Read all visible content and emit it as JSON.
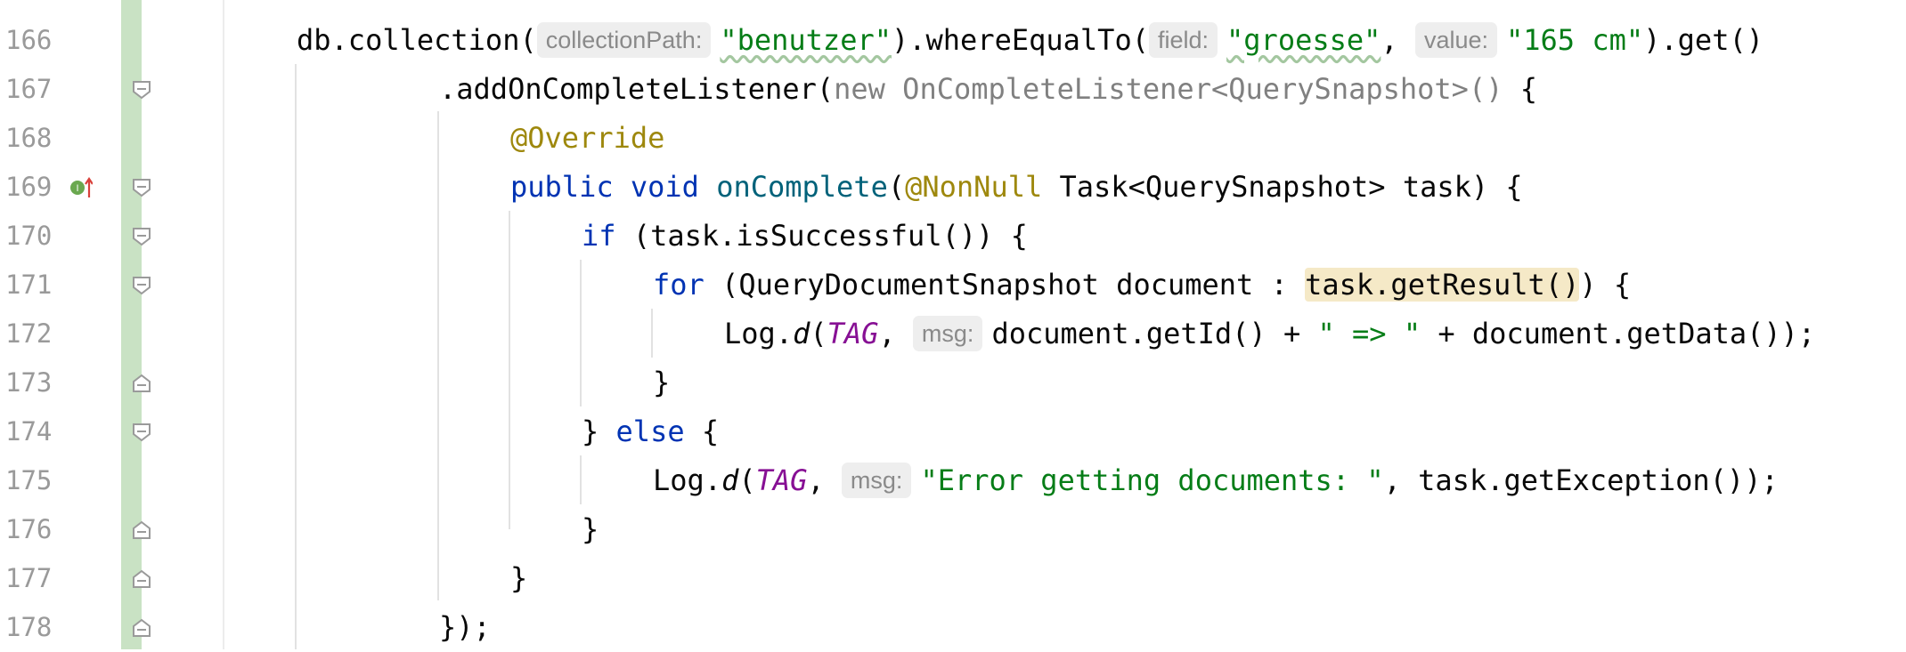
{
  "editor": {
    "lines": [
      {
        "number": "166",
        "tokens": [
          {
            "t": "db.collection(",
            "c": ""
          },
          {
            "t": "collectionPath:",
            "c": "hint"
          },
          {
            "t": "\"benutzer\"",
            "c": "str squiggle"
          },
          {
            "t": ").whereEqualTo(",
            "c": ""
          },
          {
            "t": "field:",
            "c": "hint"
          },
          {
            "t": "\"groesse\"",
            "c": "str squiggle"
          },
          {
            "t": ", ",
            "c": ""
          },
          {
            "t": "value:",
            "c": "hint"
          },
          {
            "t": "\"165 cm\"",
            "c": "str"
          },
          {
            "t": ").get()",
            "c": ""
          }
        ]
      },
      {
        "number": "167",
        "tokens": [
          {
            "t": ".addOnCompleteListener(",
            "c": ""
          },
          {
            "t": "new OnCompleteListener<QuerySnapshot>() ",
            "c": "grey"
          },
          {
            "t": "{",
            "c": ""
          }
        ]
      },
      {
        "number": "168",
        "tokens": [
          {
            "t": "@Override",
            "c": "ann"
          }
        ]
      },
      {
        "number": "169",
        "tokens": [
          {
            "t": "public void ",
            "c": "kw"
          },
          {
            "t": "onComplete",
            "c": "fn"
          },
          {
            "t": "(",
            "c": ""
          },
          {
            "t": "@NonNull",
            "c": "ann"
          },
          {
            "t": " Task<QuerySnapshot> task) {",
            "c": ""
          }
        ]
      },
      {
        "number": "170",
        "tokens": [
          {
            "t": "if",
            "c": "kw"
          },
          {
            "t": " (task.isSuccessful()) {",
            "c": ""
          }
        ]
      },
      {
        "number": "171",
        "tokens": [
          {
            "t": "for",
            "c": "kw"
          },
          {
            "t": " (QueryDocumentSnapshot document : ",
            "c": ""
          },
          {
            "t": "task.getResult()",
            "c": "hl"
          },
          {
            "t": ") {",
            "c": ""
          }
        ]
      },
      {
        "number": "172",
        "tokens": [
          {
            "t": "Log.",
            "c": ""
          },
          {
            "t": "d",
            "c": "it"
          },
          {
            "t": "(",
            "c": ""
          },
          {
            "t": "TAG",
            "c": "const"
          },
          {
            "t": ", ",
            "c": ""
          },
          {
            "t": "msg:",
            "c": "hint"
          },
          {
            "t": "document.getId() + ",
            "c": ""
          },
          {
            "t": "\" => \"",
            "c": "str"
          },
          {
            "t": " + document.getData());",
            "c": ""
          }
        ]
      },
      {
        "number": "173",
        "tokens": [
          {
            "t": "}",
            "c": ""
          }
        ]
      },
      {
        "number": "174",
        "tokens": [
          {
            "t": "} ",
            "c": ""
          },
          {
            "t": "else",
            "c": "kw"
          },
          {
            "t": " {",
            "c": ""
          }
        ]
      },
      {
        "number": "175",
        "tokens": [
          {
            "t": "Log.",
            "c": ""
          },
          {
            "t": "d",
            "c": "it"
          },
          {
            "t": "(",
            "c": ""
          },
          {
            "t": "TAG",
            "c": "const"
          },
          {
            "t": ", ",
            "c": ""
          },
          {
            "t": "msg:",
            "c": "hint"
          },
          {
            "t": "\"Error getting documents: \"",
            "c": "str"
          },
          {
            "t": ", task.getException());",
            "c": ""
          }
        ]
      },
      {
        "number": "176",
        "tokens": [
          {
            "t": "}",
            "c": ""
          }
        ]
      },
      {
        "number": "177",
        "tokens": [
          {
            "t": "}",
            "c": ""
          }
        ]
      },
      {
        "number": "178",
        "tokens": [
          {
            "t": "});",
            "c": ""
          }
        ]
      }
    ]
  },
  "colors": {
    "keyword": "#0033b3",
    "annotation": "#9e880d",
    "string": "#067d17",
    "method": "#00627a",
    "constant": "#871094",
    "vcs_added": "#c9e2c4",
    "usage_highlight": "#f5e9c7"
  },
  "icons": {
    "implements_marker": "implementing-method-icon",
    "fold_open": "fold-open-icon",
    "fold_end": "fold-end-icon"
  }
}
